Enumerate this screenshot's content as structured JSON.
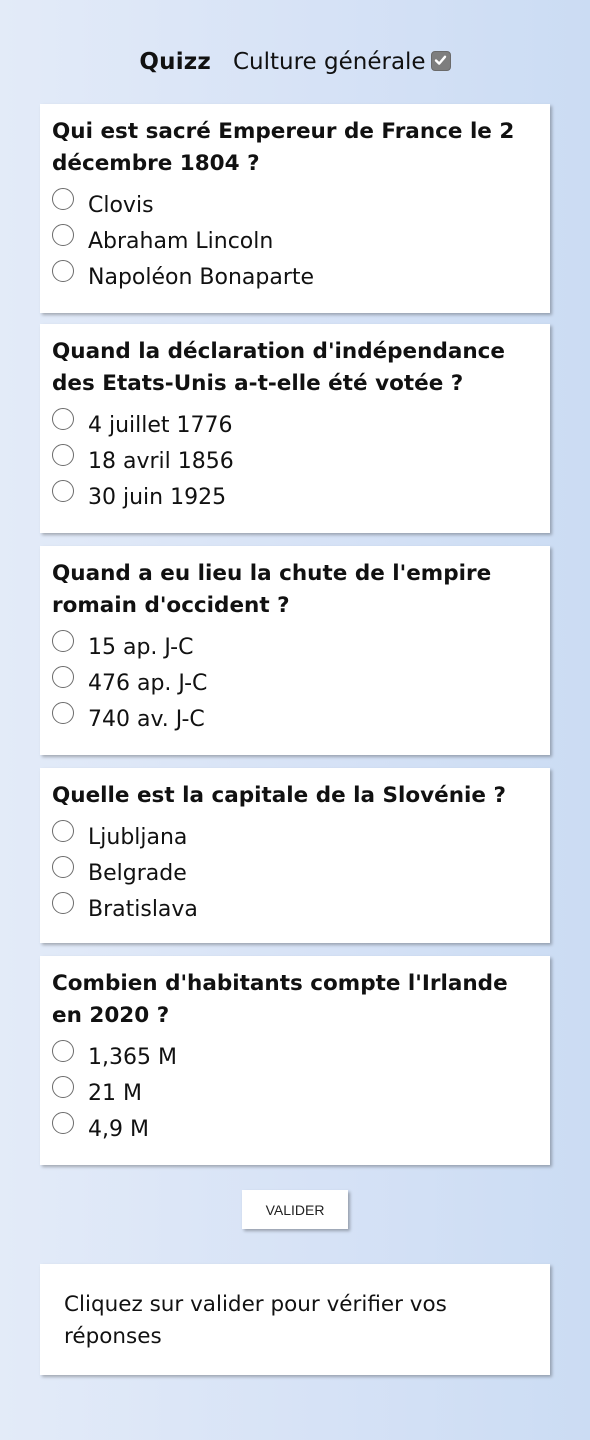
{
  "header": {
    "brand": "Quizz",
    "subtitle": "Culture générale",
    "check_icon": "checked-checkbox-icon"
  },
  "questions": [
    {
      "text": "Qui est sacré Empereur de France le 2 décembre 1804 ?",
      "options": [
        "Clovis",
        "Abraham Lincoln",
        "Napoléon Bonaparte"
      ]
    },
    {
      "text": "Quand la déclaration d'indépendance des Etats-Unis a-t-elle été votée ?",
      "options": [
        "4 juillet 1776",
        "18 avril 1856",
        "30 juin 1925"
      ]
    },
    {
      "text": "Quand a eu lieu la chute de l'empire romain d'occident ?",
      "options": [
        "15 ap. J-C",
        "476 ap. J-C",
        "740 av. J-C"
      ]
    },
    {
      "text": "Quelle est la capitale de la Slovénie ?",
      "options": [
        "Ljubljana",
        "Belgrade",
        "Bratislava"
      ]
    },
    {
      "text": "Combien d'habitants compte l'Irlande en 2020 ?",
      "options": [
        "1,365 M",
        "21 M",
        "4,9 M"
      ]
    }
  ],
  "submit_label": "VALIDER",
  "result_text": "Cliquez sur valider pour vérifier vos réponses"
}
